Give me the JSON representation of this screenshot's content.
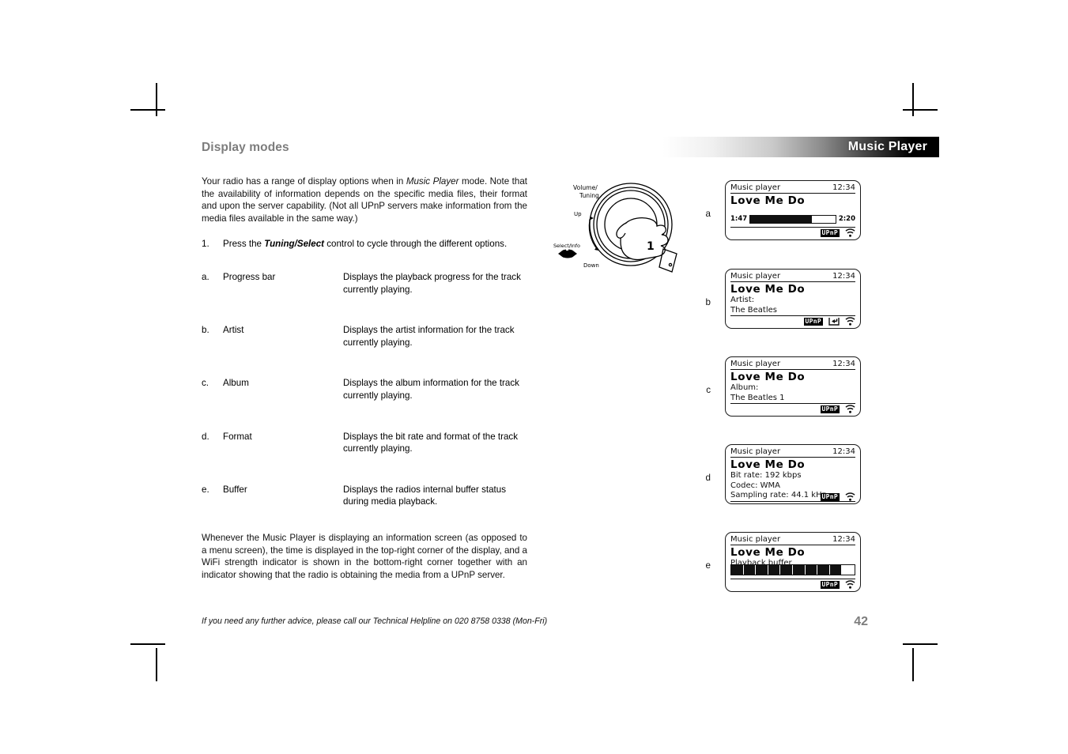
{
  "header": {
    "title": "Music Player"
  },
  "section": {
    "heading": "Display modes"
  },
  "intro": {
    "part1": "Your radio has a range of display options when in ",
    "emphasis": "Music Player",
    "part2": " mode. Note that the availability of information depends on the specific media files, their format and upon the server capability. (Not all UPnP servers make information from the media files available in the same way.)"
  },
  "steps": [
    {
      "marker": "1.",
      "pre": "Press the ",
      "bold": "Tuning/Select",
      "post": " control to cycle through the different options."
    }
  ],
  "definitions": [
    {
      "marker": "a.",
      "term": "Progress bar",
      "desc": "Displays the playback progress for the track currently playing."
    },
    {
      "marker": "b.",
      "term": "Artist",
      "desc": "Displays the artist information for the track currently playing."
    },
    {
      "marker": "c.",
      "term": "Album",
      "desc": "Displays the album information for the track currently playing."
    },
    {
      "marker": "d.",
      "term": "Format",
      "desc": "Displays the bit rate and format of the track currently playing."
    },
    {
      "marker": "e.",
      "term": "Buffer",
      "desc": "Displays the radios internal buffer status during media playback."
    }
  ],
  "closing": "Whenever the Music Player is displaying an information screen (as opposed to a menu screen), the time is displayed in the top-right corner of the display, and a WiFi strength indicator is shown in the bottom-right corner together with an indicator showing that the radio is obtaining the media from a UPnP server.",
  "knob": {
    "label_volume_tuning": "Volume/\nTuning",
    "label_volume": "Volume/",
    "label_tuning": "Tuning",
    "label_up": "Up",
    "label_select_info": "Select/Info",
    "label_down": "Down",
    "callout": "1"
  },
  "screens": [
    {
      "letter": "a",
      "mode": "Music player",
      "time": "12:34",
      "track": "Love Me Do",
      "lines": [],
      "progress": {
        "elapsed": "1:47",
        "total": "2:20",
        "percent": 72
      },
      "badge": "UPnP",
      "has_return_icon": false,
      "wifi": "wifi-icon"
    },
    {
      "letter": "b",
      "mode": "Music player",
      "time": "12:34",
      "track": "Love Me Do",
      "lines": [
        "Artist:",
        "The Beatles"
      ],
      "badge": "UPnP",
      "has_return_icon": true,
      "wifi": "wifi-icon"
    },
    {
      "letter": "c",
      "mode": "Music player",
      "time": "12:34",
      "track": "Love Me Do",
      "lines": [
        "Album:",
        "The Beatles 1"
      ],
      "badge": "UPnP",
      "has_return_icon": false,
      "wifi": "wifi-icon"
    },
    {
      "letter": "d",
      "mode": "Music player",
      "time": "12:34",
      "track": "Love Me Do",
      "lines": [
        "Bit rate: 192 kbps",
        "Codec: WMA",
        "Sampling rate: 44.1 kHz"
      ],
      "badge": "UPnP",
      "has_return_icon": false,
      "wifi": "wifi-icon"
    },
    {
      "letter": "e",
      "mode": "Music player",
      "time": "12:34",
      "track": "Love Me Do",
      "lines": [
        "Playback buffer"
      ],
      "buffer": {
        "segments": 10,
        "filled": 9
      },
      "badge": "UPnP",
      "has_return_icon": false,
      "wifi": "wifi-icon"
    }
  ],
  "footer": {
    "note": "If you need any further advice, please call our Technical Helpline on 020 8758 0338 (Mon-Fri)",
    "page_number": "42"
  },
  "colors": {
    "heading_gray": "#7d7d7d",
    "page_number_gray": "#7d7d7d",
    "ink": "#111111",
    "header_bar_dark": "#000000",
    "header_bar_light": "#ffffff"
  }
}
